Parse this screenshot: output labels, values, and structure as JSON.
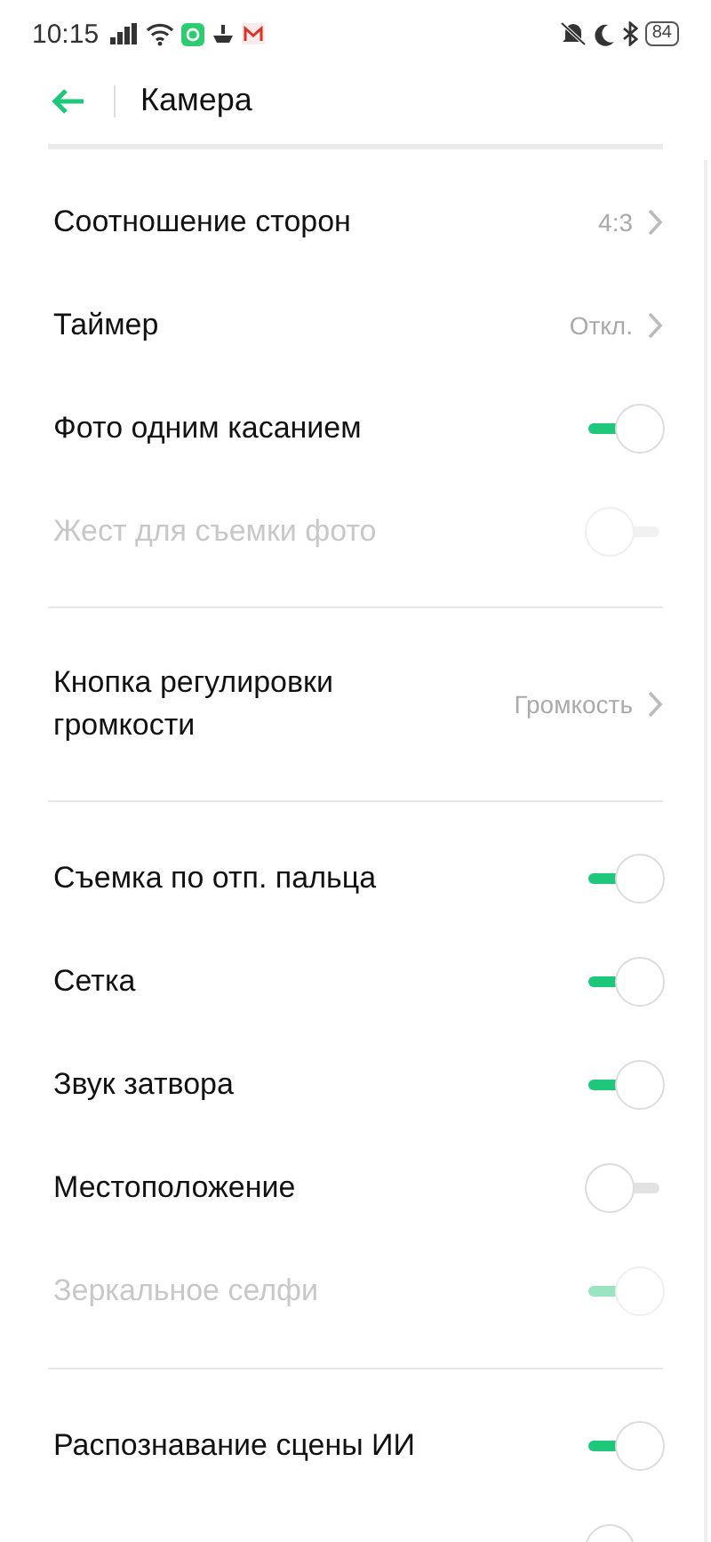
{
  "status_bar": {
    "time": "10:15",
    "battery": "84"
  },
  "header": {
    "title": "Камера"
  },
  "sections": [
    {
      "rows": [
        {
          "kind": "value",
          "label": "Соотношение сторон",
          "value": "4:3",
          "disabled": false
        },
        {
          "kind": "value",
          "label": "Таймер",
          "value": "Откл.",
          "disabled": false
        },
        {
          "kind": "toggle",
          "label": "Фото одним касанием",
          "on": true,
          "disabled": false
        },
        {
          "kind": "toggle",
          "label": "Жест для съемки фото",
          "on": false,
          "disabled": true
        }
      ]
    },
    {
      "rows": [
        {
          "kind": "value",
          "label": "Кнопка регулировки громкости",
          "value": "Громкость",
          "disabled": false
        }
      ]
    },
    {
      "rows": [
        {
          "kind": "toggle",
          "label": "Съемка по отп. пальца",
          "on": true,
          "disabled": false
        },
        {
          "kind": "toggle",
          "label": "Сетка",
          "on": true,
          "disabled": false
        },
        {
          "kind": "toggle",
          "label": "Звук затвора",
          "on": true,
          "disabled": false
        },
        {
          "kind": "toggle",
          "label": "Местоположение",
          "on": false,
          "disabled": false
        },
        {
          "kind": "toggle",
          "label": "Зеркальное селфи",
          "on": true,
          "disabled": true
        }
      ]
    },
    {
      "rows": [
        {
          "kind": "toggle",
          "label": "Распознавание сцены ИИ",
          "on": true,
          "disabled": false
        },
        {
          "kind": "toggle",
          "on": false,
          "disabled": false
        }
      ]
    }
  ]
}
